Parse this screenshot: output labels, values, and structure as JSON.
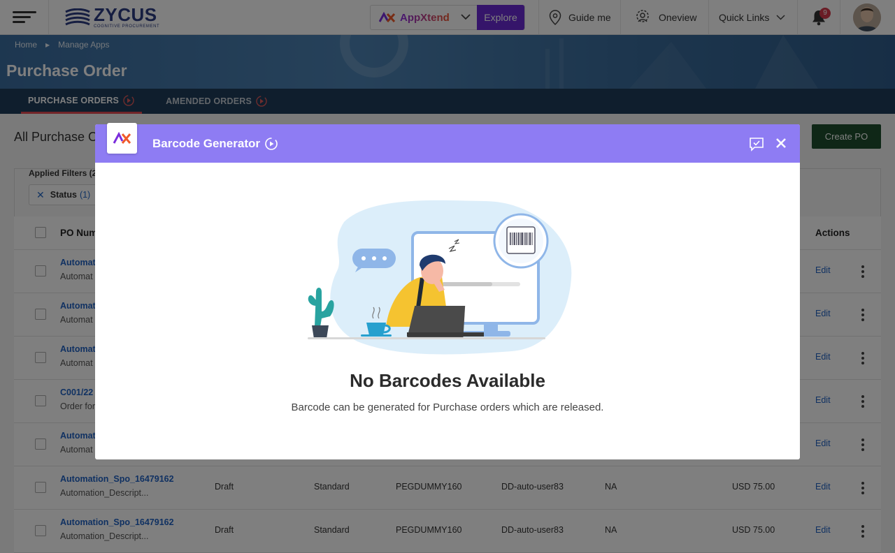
{
  "header": {
    "logo_main": "ZYCUS",
    "logo_sub": "COGNITIVE PROCUREMENT",
    "appxtend_label": "AppXtend",
    "explore_label": "Explore",
    "guide_label": "Guide me",
    "oneview_label": "Oneview",
    "quicklinks_label": "Quick Links",
    "notification_count": "9"
  },
  "breadcrumb": {
    "home": "Home",
    "current": "Manage Apps"
  },
  "page_title": "Purchase Order",
  "tabs": [
    {
      "label": "PURCHASE ORDERS",
      "active": true
    },
    {
      "label": "AMENDED ORDERS",
      "active": false
    }
  ],
  "content": {
    "title": "All Purchase O",
    "create_label": "Create PO",
    "filters_label": "Applied Filters (2",
    "filter_chip": {
      "label": "Status",
      "count": "(1)"
    }
  },
  "table": {
    "headers": {
      "po_number": "PO Num",
      "actions": "Actions"
    },
    "rows": [
      {
        "po": "Automat",
        "desc": "Automat",
        "status": "",
        "type": "",
        "company": "",
        "requester": "",
        "supplier": "",
        "amount": "",
        "action": "Edit"
      },
      {
        "po": "Automat",
        "desc": "Automat",
        "status": "",
        "type": "",
        "company": "",
        "requester": "",
        "supplier": "",
        "amount": "",
        "action": "Edit"
      },
      {
        "po": "Automat",
        "desc": "Automat",
        "status": "",
        "type": "",
        "company": "",
        "requester": "",
        "supplier": "",
        "amount": "",
        "action": "Edit"
      },
      {
        "po": "C001/22",
        "desc": "Order for",
        "status": "",
        "type": "",
        "company": "",
        "requester": "",
        "supplier": "",
        "amount": "",
        "action": "Edit"
      },
      {
        "po": "Automat",
        "desc": "Automat",
        "status": "",
        "type": "",
        "company": "",
        "requester": "",
        "supplier": "",
        "amount": "",
        "action": "Edit"
      },
      {
        "po": "Automation_Spo_16479162",
        "desc": "Automation_Descript...",
        "status": "Draft",
        "type": "Standard",
        "company": "PEGDUMMY160",
        "requester": "DD-auto-user83",
        "supplier": "NA",
        "amount": "USD 75.00",
        "action": "Edit"
      },
      {
        "po": "Automation_Spo_16479162",
        "desc": "Automation_Descript...",
        "status": "Draft",
        "type": "Standard",
        "company": "PEGDUMMY160",
        "requester": "DD-auto-user83",
        "supplier": "NA",
        "amount": "USD 75.00",
        "action": "Edit"
      }
    ]
  },
  "modal": {
    "title": "Barcode Generator",
    "empty_title": "No Barcodes Available",
    "empty_subtitle": "Barcode can be generated for Purchase orders which are released."
  },
  "colors": {
    "modal_header": "#8e7cf3",
    "explore": "#6a2bd4",
    "create_po": "#1e4f2e",
    "link": "#2163c5",
    "tab_indicator": "#e44b52"
  }
}
